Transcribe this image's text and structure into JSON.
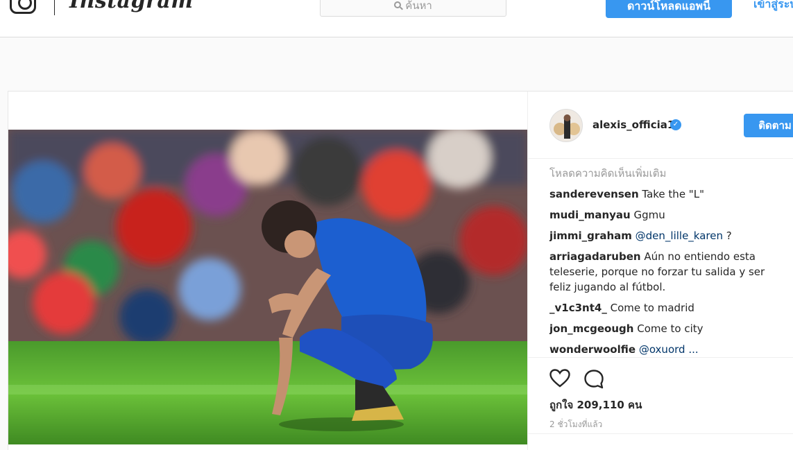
{
  "nav": {
    "logo_text": "Instagram",
    "search_placeholder": "ค้นหา",
    "download_app_label": "ดาวน์โหลดแอพนี้",
    "login_label": "เข้าสู่ระบบ"
  },
  "post": {
    "username": "alexis_officia1",
    "verified": true,
    "follow_label": "ติดตาม",
    "load_more_label": "โหลดความคิดเห็นเพิ่มเติม",
    "comments": [
      {
        "user": "sanderevensen",
        "text": "Take the \"L\""
      },
      {
        "user": "mudi_manyau",
        "text": "Ggmu"
      },
      {
        "user": "jimmi_graham",
        "mention": "@den_lille_karen",
        "text": " ?"
      },
      {
        "user": "arriagadaruben",
        "text": "Aún no entiendo esta teleserie, porque no forzar tu salida y ser feliz jugando al fútbol."
      },
      {
        "user": "_v1c3nt4_",
        "text": "Come to madrid"
      },
      {
        "user": "jon_mcgeough",
        "text": "Come to city"
      },
      {
        "user": "wonderwoolfie",
        "text": "@oxuord ..."
      }
    ],
    "likes_label": "ถูกใจ 209,110 คน",
    "time_label": "2 ชั่วโมงที่แล้ว"
  },
  "colors": {
    "accent": "#3897f0",
    "text": "#262626",
    "muted": "#999999",
    "border": "#dbdbdb"
  },
  "icons": [
    "search-icon",
    "heart-icon",
    "comment-icon",
    "verified-badge-icon",
    "instagram-glyph-icon"
  ]
}
